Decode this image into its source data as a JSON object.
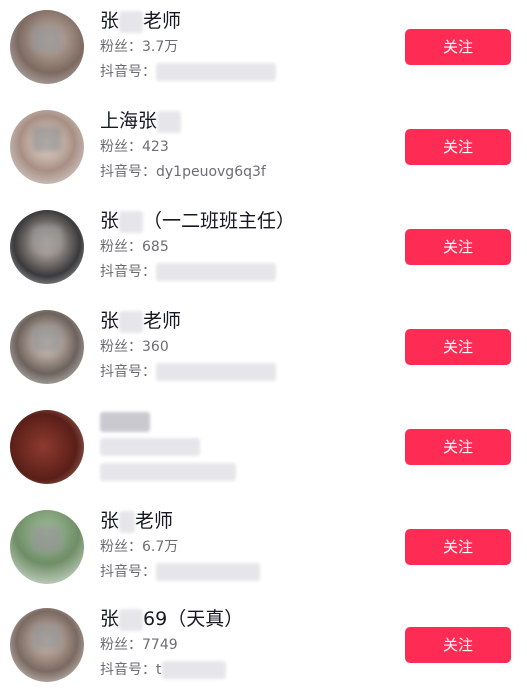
{
  "follow_label": "关注",
  "users": [
    {
      "name_pre": "张",
      "name_post": "老师",
      "fans": "粉丝：3.7万",
      "douyin_label": "抖音号：",
      "douyin_id": ""
    },
    {
      "name_pre": "上海张",
      "name_post": "",
      "fans": "粉丝：423",
      "douyin_label": "抖音号：",
      "douyin_id": "dy1peuovg6q3f"
    },
    {
      "name_pre": "张",
      "name_post": "（一二班班主任）",
      "fans": "粉丝：685",
      "douyin_label": "抖音号：",
      "douyin_id": ""
    },
    {
      "name_pre": "张",
      "name_post": "老师",
      "fans": "粉丝：360",
      "douyin_label": "抖音号：",
      "douyin_id": ""
    },
    {
      "name_pre": "",
      "name_post": "",
      "fans": "",
      "douyin_label": "",
      "douyin_id": ""
    },
    {
      "name_pre": "张",
      "name_post": "老师",
      "fans": "粉丝：6.7万",
      "douyin_label": "抖音号：",
      "douyin_id": ""
    },
    {
      "name_pre": "张",
      "name_post": "69（天真）",
      "fans": "粉丝：7749",
      "douyin_label": "抖音号：",
      "douyin_id": "t"
    }
  ]
}
